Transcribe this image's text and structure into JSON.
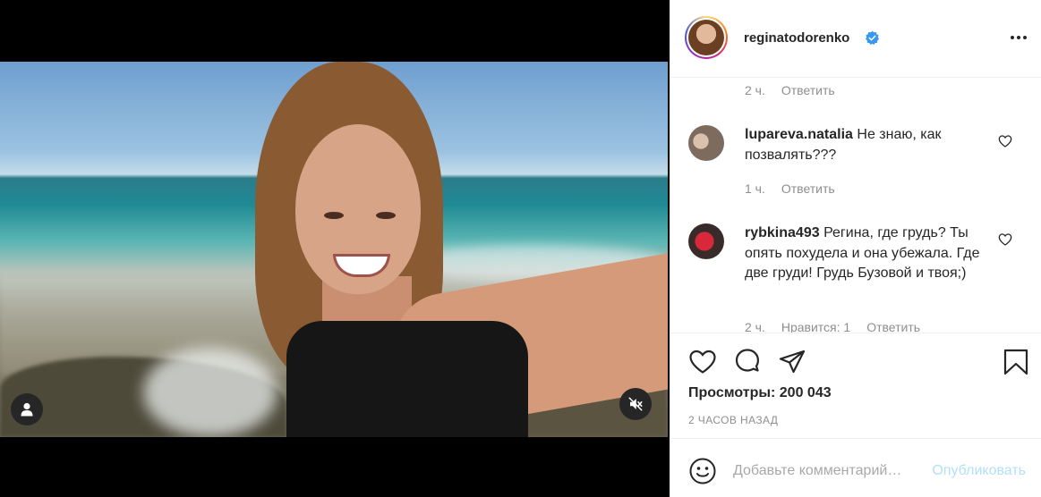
{
  "post": {
    "username": "reginatodorenko",
    "verified": true
  },
  "comments_top": {
    "time": "2 ч.",
    "reply": "Ответить"
  },
  "comments": [
    {
      "username": "lupareva.natalia",
      "text": "Не знаю, как позвалять???",
      "time": "1 ч.",
      "reply": "Ответить"
    },
    {
      "username": "rybkina493",
      "text": "Регина, где грудь? Ты опять похудела и она убежала. Где две груди! Грудь Бузовой и твоя;)",
      "time": "2 ч.",
      "likes": "Нравится: 1",
      "reply": "Ответить"
    }
  ],
  "stats": {
    "views": "Просмотры: 200 043",
    "time_ago": "2 ЧАСОВ НАЗАД"
  },
  "comment_box": {
    "placeholder": "Добавьте комментарий…",
    "publish": "Опубликовать"
  },
  "icons": {
    "more": "more-horizontal-icon",
    "like": "heart-icon",
    "comment": "comment-bubble-icon",
    "share": "paper-plane-icon",
    "save": "bookmark-icon",
    "emoji": "smiley-icon",
    "user_tag": "user-icon",
    "mute": "sound-off-icon",
    "verified": "verified-badge-icon"
  },
  "colors": {
    "accent": "#0095f6",
    "publish_disabled": "#b2dffc",
    "verified": "#3897f0",
    "muted_text": "#8e8e8e"
  }
}
